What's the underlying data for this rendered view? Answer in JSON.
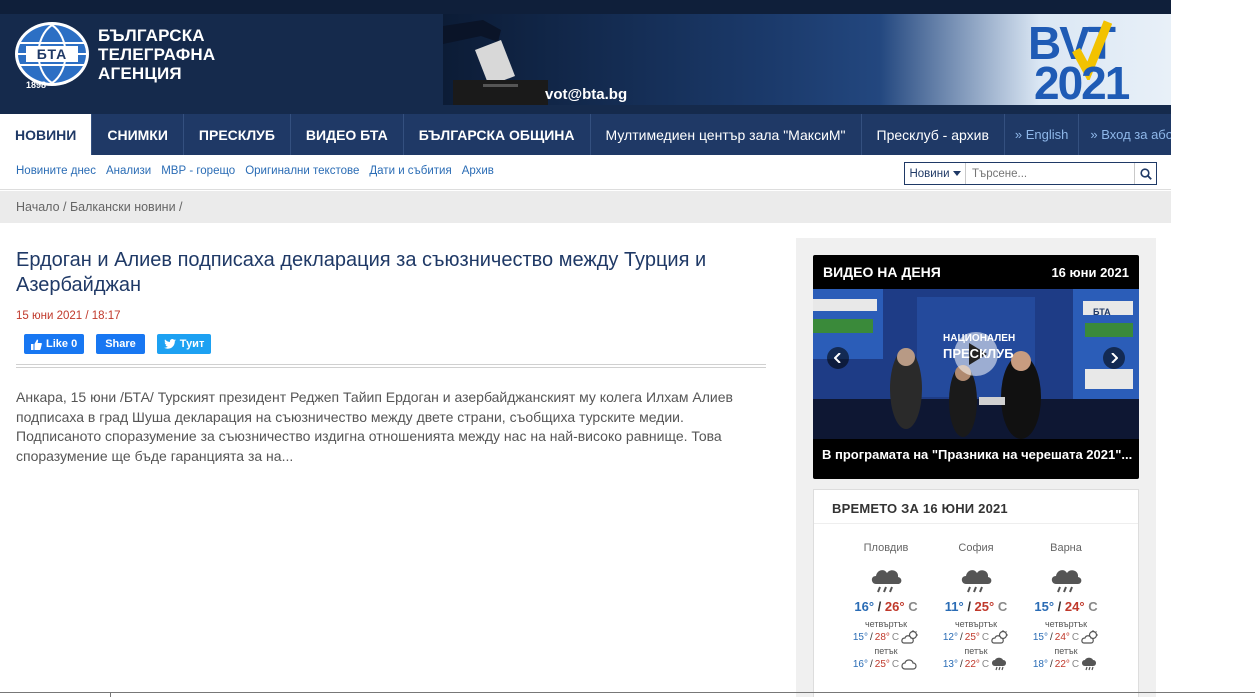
{
  "header": {
    "logo_lines": [
      "БЪЛГАРСКА",
      "ТЕЛЕГРАФНА",
      "АГЕНЦИЯ"
    ],
    "logo_abbr": "БТА",
    "logo_year": "1898",
    "banner_email": "vot@bta.bg",
    "banner_vot_top": "BVT",
    "banner_vot_year": "2021"
  },
  "mainnav": {
    "items": [
      "НОВИНИ",
      "СНИМКИ",
      "ПРЕСКЛУБ",
      "ВИДЕО БТА",
      "БЪЛГАРСКА ОБЩИНА",
      "Мултимедиен център зала \"МаксиМ\"",
      "Пресклуб - архив"
    ],
    "english": "» English",
    "login": "» Вход за абонати"
  },
  "subnav": {
    "items": [
      "Новините днес",
      "Анализи",
      "МВР - горещо",
      "Оригинални текстове",
      "Дати и събития",
      "Архив"
    ]
  },
  "search": {
    "category": "Новини",
    "placeholder": "Търсене..."
  },
  "breadcrumb": "Начало / Балкански новини /",
  "article": {
    "title": "Ердоган и Алиев подписаха декларация за съюзничество между Турция и Азербайджан",
    "date": "15 юни 2021 / 18:17",
    "like_label": "Like 0",
    "share_label": "Share",
    "tweet_label": "Туит",
    "body": "Анкара, 15 юни /БТА/ Турският президент Реджеп Тайип Ердоган и азербайджанският му колега Илхам Алиев подписаха в град Шуша декларация на съюзничество между двете страни, съобщиха турските медии. Подписаното споразумение за съюзничество издигна отношенията между нас на най-високо равнище. Това споразумение ще бъде гаранцията за на..."
  },
  "video": {
    "heading": "ВИДЕО НА ДЕНЯ",
    "date": "16 юни 2021",
    "caption": "В програмата на \"Празника на черешата 2021\"...",
    "screen_text_1": "НАЦИОНАЛЕН",
    "screen_text_2": "ПРЕСКЛУБ",
    "logo_text": "БТА"
  },
  "weather": {
    "title": "ВРЕМЕТО ЗА 16 ЮНИ 2021",
    "cities": [
      {
        "name": "Пловдив",
        "min": "16°",
        "max": "26°",
        "unit": "С",
        "d1": "четвъртък",
        "d1_min": "15°",
        "d1_max": "28°",
        "d1_icon": "sun-cloud-icon",
        "d2": "петък",
        "d2_min": "16°",
        "d2_max": "25°",
        "d2_icon": "cloud-icon"
      },
      {
        "name": "София",
        "min": "11°",
        "max": "25°",
        "unit": "С",
        "d1": "четвъртък",
        "d1_min": "12°",
        "d1_max": "25°",
        "d1_icon": "sun-cloud-icon",
        "d2": "петък",
        "d2_min": "13°",
        "d2_max": "22°",
        "d2_icon": "rain-cloud-icon"
      },
      {
        "name": "Варна",
        "min": "15°",
        "max": "24°",
        "unit": "С",
        "d1": "четвъртък",
        "d1_min": "15°",
        "d1_max": "24°",
        "d1_icon": "sun-cloud-icon",
        "d2": "петък",
        "d2_min": "18°",
        "d2_max": "22°",
        "d2_icon": "rain-cloud-icon"
      }
    ]
  }
}
